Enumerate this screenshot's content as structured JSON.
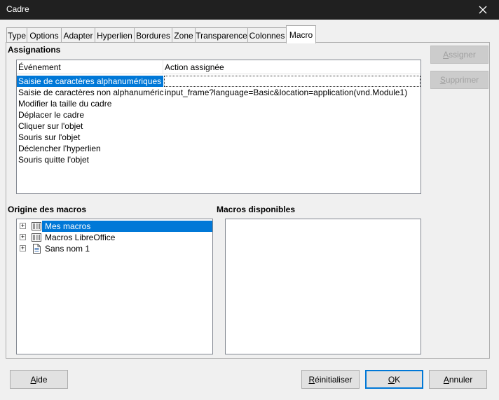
{
  "window": {
    "title": "Cadre"
  },
  "tabs": [
    {
      "label": "Type"
    },
    {
      "label": "Options"
    },
    {
      "label": "Adapter"
    },
    {
      "label": "Hyperlien"
    },
    {
      "label": "Bordures"
    },
    {
      "label": "Zone"
    },
    {
      "label": "Transparence"
    },
    {
      "label": "Colonnes"
    },
    {
      "label": "Macro"
    }
  ],
  "active_tab": "Macro",
  "assignations": {
    "section_label": "Assignations",
    "columns": [
      "Événement",
      "Action assignée"
    ],
    "rows": [
      {
        "event": "Saisie de caractères alphanumériques",
        "action": ""
      },
      {
        "event": "Saisie de caractères non alphanuméric",
        "action": "input_frame?language=Basic&location=application(vnd.Module1)"
      },
      {
        "event": "Modifier la taille du cadre",
        "action": ""
      },
      {
        "event": "Déplacer le cadre",
        "action": ""
      },
      {
        "event": "Cliquer sur l'objet",
        "action": ""
      },
      {
        "event": "Souris sur l'objet",
        "action": ""
      },
      {
        "event": "Déclencher l'hyperlien",
        "action": ""
      },
      {
        "event": "Souris quitte l'objet",
        "action": ""
      }
    ],
    "assign_button": {
      "pre": "",
      "key": "A",
      "post": "ssigner"
    },
    "remove_button": {
      "pre": "",
      "key": "S",
      "post": "upprimer"
    }
  },
  "macro_origin": {
    "section_label": "Origine des macros",
    "items": [
      {
        "label": "Mes macros",
        "icon": "library-icon"
      },
      {
        "label": "Macros LibreOffice",
        "icon": "library-icon"
      },
      {
        "label": "Sans nom 1",
        "icon": "document-icon"
      }
    ],
    "expander": "+"
  },
  "available_macros": {
    "section_label": "Macros disponibles"
  },
  "footer": {
    "help": {
      "pre": "",
      "key": "A",
      "post": "ide"
    },
    "reset": {
      "pre": "",
      "key": "R",
      "post": "éinitialiser"
    },
    "ok": {
      "pre": "",
      "key": "O",
      "post": "K"
    },
    "cancel": {
      "pre": "",
      "key": "A",
      "post": "nnuler"
    }
  },
  "colors": {
    "selection": "#0078d7",
    "titlebar": "#202020"
  }
}
